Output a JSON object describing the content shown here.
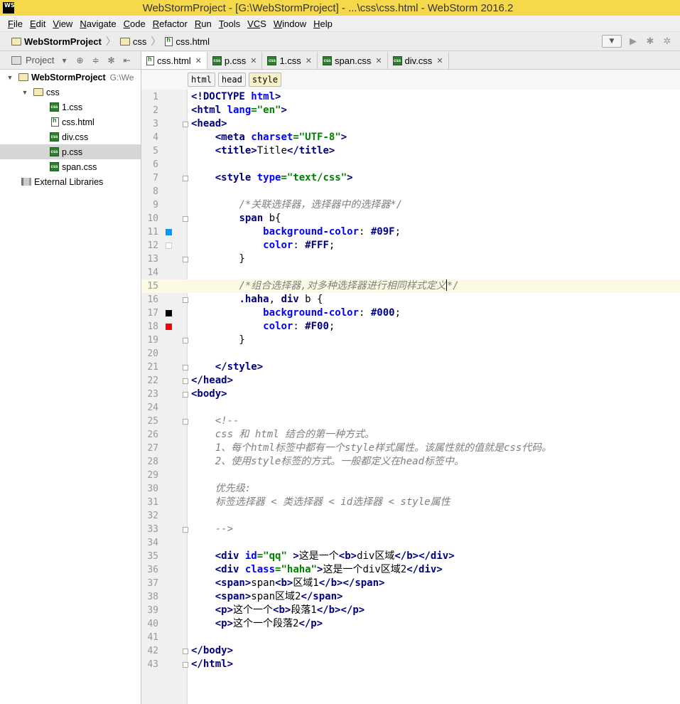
{
  "window": {
    "title": "WebStormProject - [G:\\WebStormProject] - ...\\css\\css.html - WebStorm 2016.2",
    "logo_text": "WS"
  },
  "menu": [
    {
      "key": "F",
      "rest": "ile"
    },
    {
      "key": "E",
      "rest": "dit"
    },
    {
      "key": "V",
      "rest": "iew"
    },
    {
      "key": "N",
      "rest": "avigate"
    },
    {
      "key": "C",
      "rest": "ode"
    },
    {
      "key": "R",
      "rest": "efactor"
    },
    {
      "key": "R",
      "rest": "un"
    },
    {
      "key": "T",
      "rest": "ools"
    },
    {
      "key": "VC",
      "rest": "S"
    },
    {
      "key": "W",
      "rest": "indow"
    },
    {
      "key": "H",
      "rest": "elp"
    }
  ],
  "breadcrumb": [
    "WebStormProject",
    "css",
    "css.html"
  ],
  "project_panel": {
    "label": "Project",
    "tree": [
      {
        "label": "WebStormProject",
        "path": "G:\\We",
        "type": "folder",
        "level": 0,
        "bold": true,
        "expanded": true
      },
      {
        "label": "css",
        "type": "folder",
        "level": 1,
        "expanded": true
      },
      {
        "label": "1.css",
        "type": "css",
        "level": 2
      },
      {
        "label": "css.html",
        "type": "html",
        "level": 2
      },
      {
        "label": "div.css",
        "type": "css",
        "level": 2
      },
      {
        "label": "p.css",
        "type": "css",
        "level": 2,
        "selected": true
      },
      {
        "label": "span.css",
        "type": "css",
        "level": 2
      },
      {
        "label": "External Libraries",
        "type": "lib",
        "level": 0
      }
    ]
  },
  "tabs": [
    {
      "label": "css.html",
      "type": "html",
      "active": true
    },
    {
      "label": "p.css",
      "type": "css"
    },
    {
      "label": "1.css",
      "type": "css"
    },
    {
      "label": "span.css",
      "type": "css"
    },
    {
      "label": "div.css",
      "type": "css"
    }
  ],
  "tag_breadcrumb": [
    "html",
    "head",
    "style"
  ],
  "editor": {
    "current_line": 15,
    "lines": [
      [
        [
          "tg",
          "<!DOCTYPE "
        ],
        [
          "at",
          "html"
        ],
        [
          "tg",
          ">"
        ]
      ],
      [
        [
          "tg",
          "<html "
        ],
        [
          "at",
          "lang"
        ],
        [
          "st",
          "=\"en\""
        ],
        [
          "tg",
          ">"
        ]
      ],
      [
        [
          "tg",
          "<head>"
        ]
      ],
      [
        [
          "",
          "    "
        ],
        [
          "tg",
          "<meta "
        ],
        [
          "at",
          "charset"
        ],
        [
          "st",
          "=\"UTF-8\""
        ],
        [
          "tg",
          ">"
        ]
      ],
      [
        [
          "",
          "    "
        ],
        [
          "tg",
          "<title>"
        ],
        [
          "",
          "Title"
        ],
        [
          "tg",
          "</title>"
        ]
      ],
      [],
      [
        [
          "",
          "    "
        ],
        [
          "tg",
          "<style "
        ],
        [
          "at",
          "type"
        ],
        [
          "st",
          "=\"text/css\""
        ],
        [
          "tg",
          ">"
        ]
      ],
      [],
      [
        [
          "",
          "        "
        ],
        [
          "cm",
          "/*关联选择器，选择器中的选择器*/"
        ]
      ],
      [
        [
          "",
          "        "
        ],
        [
          "sl",
          "span"
        ],
        [
          "",
          " b{"
        ]
      ],
      [
        [
          "",
          "            "
        ],
        [
          "pr",
          "background-color"
        ],
        [
          "",
          ": "
        ],
        [
          "vl",
          "#09F"
        ],
        [
          "",
          ";"
        ]
      ],
      [
        [
          "",
          "            "
        ],
        [
          "pr",
          "color"
        ],
        [
          "",
          ": "
        ],
        [
          "vl",
          "#FFF"
        ],
        [
          "",
          ";"
        ]
      ],
      [
        [
          "",
          "        }"
        ]
      ],
      [],
      [
        [
          "",
          "        "
        ],
        [
          "cm",
          "/*组合选择器,对多种选择器进行相同样式定义"
        ],
        [
          "cursor",
          ""
        ],
        [
          "cm",
          "*/"
        ]
      ],
      [
        [
          "",
          "        "
        ],
        [
          "sl",
          ".haha"
        ],
        [
          "",
          ", "
        ],
        [
          "sl",
          "div"
        ],
        [
          "",
          " b {"
        ]
      ],
      [
        [
          "",
          "            "
        ],
        [
          "pr",
          "background-color"
        ],
        [
          "",
          ": "
        ],
        [
          "vl",
          "#000"
        ],
        [
          "",
          ";"
        ]
      ],
      [
        [
          "",
          "            "
        ],
        [
          "pr",
          "color"
        ],
        [
          "",
          ": "
        ],
        [
          "vl",
          "#F00"
        ],
        [
          "",
          ";"
        ]
      ],
      [
        [
          "",
          "        }"
        ]
      ],
      [],
      [
        [
          "",
          "    "
        ],
        [
          "tg",
          "</style>"
        ]
      ],
      [
        [
          "tg",
          "</head>"
        ]
      ],
      [
        [
          "tg",
          "<body>"
        ]
      ],
      [],
      [
        [
          "",
          "    "
        ],
        [
          "cm",
          "<!--"
        ]
      ],
      [
        [
          "",
          "    "
        ],
        [
          "cm",
          "css 和 html 结合的第一种方式。"
        ]
      ],
      [
        [
          "",
          "    "
        ],
        [
          "cm",
          "1、每个html标签中都有一个style样式属性。该属性就的值就是css代码。"
        ]
      ],
      [
        [
          "",
          "    "
        ],
        [
          "cm",
          "2、使用style标签的方式。一般都定义在head标签中。"
        ]
      ],
      [],
      [
        [
          "",
          "    "
        ],
        [
          "cm",
          "优先级:"
        ]
      ],
      [
        [
          "",
          "    "
        ],
        [
          "cm",
          "标签选择器 < 类选择器 < id选择器 < style属性"
        ]
      ],
      [],
      [
        [
          "",
          "    "
        ],
        [
          "cm",
          "-->"
        ]
      ],
      [],
      [
        [
          "",
          "    "
        ],
        [
          "tg",
          "<div "
        ],
        [
          "at",
          "id"
        ],
        [
          "st",
          "=\"qq\""
        ],
        [
          "",
          " "
        ],
        [
          "tg",
          ">"
        ],
        [
          "",
          "这是一个"
        ],
        [
          "tg",
          "<b>"
        ],
        [
          "",
          "div区域"
        ],
        [
          "tg",
          "</b></div>"
        ]
      ],
      [
        [
          "",
          "    "
        ],
        [
          "tg",
          "<div "
        ],
        [
          "at",
          "class"
        ],
        [
          "st",
          "=\"haha\""
        ],
        [
          "tg",
          ">"
        ],
        [
          "",
          "这是一个div区域2"
        ],
        [
          "tg",
          "</div>"
        ]
      ],
      [
        [
          "",
          "    "
        ],
        [
          "tg",
          "<span>"
        ],
        [
          "",
          "span"
        ],
        [
          "tg",
          "<b>"
        ],
        [
          "",
          "区域1"
        ],
        [
          "tg",
          "</b></span>"
        ]
      ],
      [
        [
          "",
          "    "
        ],
        [
          "tg",
          "<span>"
        ],
        [
          "",
          "span区域2"
        ],
        [
          "tg",
          "</span>"
        ]
      ],
      [
        [
          "",
          "    "
        ],
        [
          "tg",
          "<p>"
        ],
        [
          "",
          "这个一个"
        ],
        [
          "tg",
          "<b>"
        ],
        [
          "",
          "段落1"
        ],
        [
          "tg",
          "</b></p>"
        ]
      ],
      [
        [
          "",
          "    "
        ],
        [
          "tg",
          "<p>"
        ],
        [
          "",
          "这个一个段落2"
        ],
        [
          "tg",
          "</p>"
        ]
      ],
      [],
      [
        [
          "tg",
          "</body>"
        ]
      ],
      [
        [
          "tg",
          "</html>"
        ]
      ]
    ],
    "color_markers": {
      "11": "#0099ff",
      "12": "#ffffff",
      "17": "#000000",
      "18": "#ff0000"
    },
    "fold_lines": [
      3,
      7,
      10,
      13,
      16,
      19,
      21,
      22,
      23,
      25,
      33,
      42,
      43
    ]
  }
}
